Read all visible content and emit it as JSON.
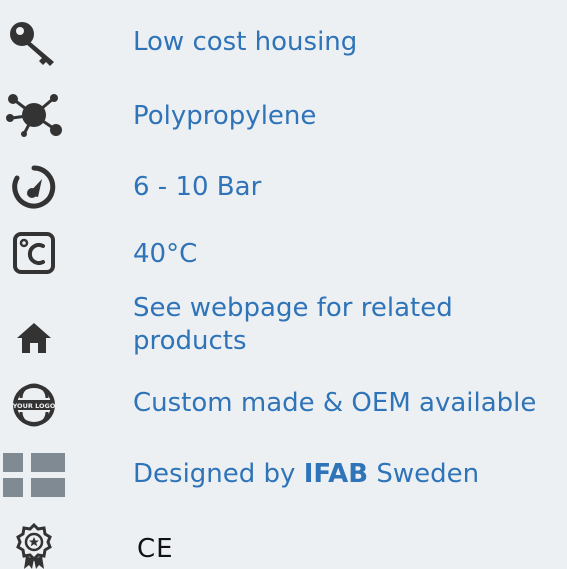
{
  "features": {
    "items": [
      {
        "icon": "key-icon",
        "label": "Low cost housing"
      },
      {
        "icon": "molecule-icon",
        "label": "Polypropylene"
      },
      {
        "icon": "pressure-gauge-icon",
        "label": "6 - 10 Bar"
      },
      {
        "icon": "temperature-celsius-icon",
        "label": "40°C"
      },
      {
        "icon": "home-icon",
        "label_line1": "See webpage for related",
        "label_line2": "products"
      },
      {
        "icon": "your-logo-icon",
        "label": "Custom made & OEM available",
        "logo_text": "YOUR LOGO"
      },
      {
        "icon": "sweden-flag-icon",
        "label_prefix": "Designed by ",
        "label_brand": "IFAB",
        "label_suffix": " Sweden"
      },
      {
        "icon": "certificate-badge-icon",
        "label": "CE"
      }
    ]
  },
  "colors": {
    "background": "#edf0f3",
    "label_text": "#2f74b8",
    "icon": "#333333",
    "flag_gray": "#7f8a92"
  }
}
